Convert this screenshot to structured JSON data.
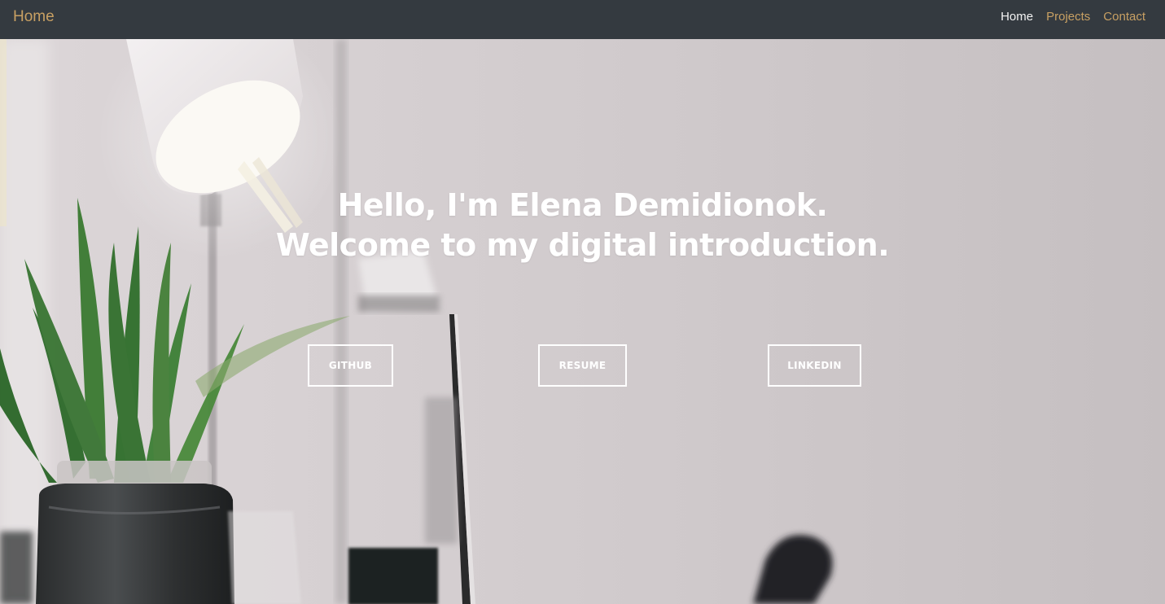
{
  "navbar": {
    "brand": "Home",
    "links": [
      {
        "label": "Home",
        "active": true
      },
      {
        "label": "Projects",
        "active": false
      },
      {
        "label": "Contact",
        "active": false
      }
    ]
  },
  "hero": {
    "line1": "Hello, I'm Elena Demidionok.",
    "line2": "Welcome to my digital introduction.",
    "buttons": {
      "github": "GITHUB",
      "resume": "RESUME",
      "linkedin": "LINKEDIN"
    }
  },
  "colors": {
    "navbar_bg": "#343a40",
    "accent": "#c8a063",
    "active_link": "#f2f2f2",
    "hero_text": "#ffffff"
  }
}
